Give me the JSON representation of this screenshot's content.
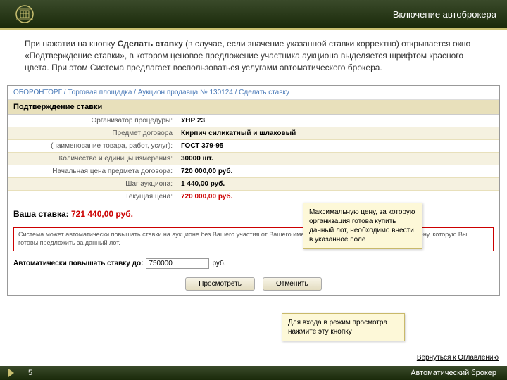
{
  "header": {
    "title": "Включение автоброкера"
  },
  "intro": {
    "p1a": "При нажатии на кнопку ",
    "p1b": "Сделать ставку",
    "p1c": " (в случае, если значение указанной ставки корректно) открывается окно «Подтверждение ставки», в котором ценовое предложение участника аукциона выделяется шрифтом красного цвета. При этом Система предлагает воспользоваться услугами автоматического брокера."
  },
  "breadcrumb": "ОБОРОНТОРГ / Торговая площадка / Аукцион продавца № 130124 / Сделать ставку",
  "panel": {
    "title": "Подтверждение ставки"
  },
  "rows": {
    "r0l": "Организатор процедуры:",
    "r0v": "УНР 23",
    "r1l": "Предмет договора",
    "r1v": "Кирпич силикатный и шлаковый",
    "r2l": "(наименование товара, работ, услуг):",
    "r2v": "ГОСТ 379-95",
    "r3l": "Количество и единицы измерения:",
    "r3v": "30000 шт.",
    "r4l": "Начальная цена предмета договора:",
    "r4v": "720 000,00 руб.",
    "r5l": "Шаг аукциона:",
    "r5v": "1 440,00 руб.",
    "r6l": "Текущая цена:",
    "r6v": "720 000,00 руб."
  },
  "bid": {
    "label": "Ваша ставка:",
    "amount": "721 440,00 руб."
  },
  "info": "Система может автоматически повышать ставки на аукционе без Вашего участия от Вашего имени. Для этого введите максимальную цену, которую Вы готовы предложить за данный лот.",
  "autoRaise": {
    "label": "Автоматически повышать ставку до:",
    "value": "750000",
    "unit": "руб."
  },
  "buttons": {
    "view": "Просмотреть",
    "cancel": "Отменить"
  },
  "callouts": {
    "c1": "Максимальную цену, за которую организация готова купить данный лот, необходимо внести в указанное поле",
    "c2": "Для входа в режим просмотра нажмите эту кнопку"
  },
  "footer": {
    "back": "Вернуться к Оглавлению",
    "page": "5",
    "section": "Автоматический брокер"
  }
}
